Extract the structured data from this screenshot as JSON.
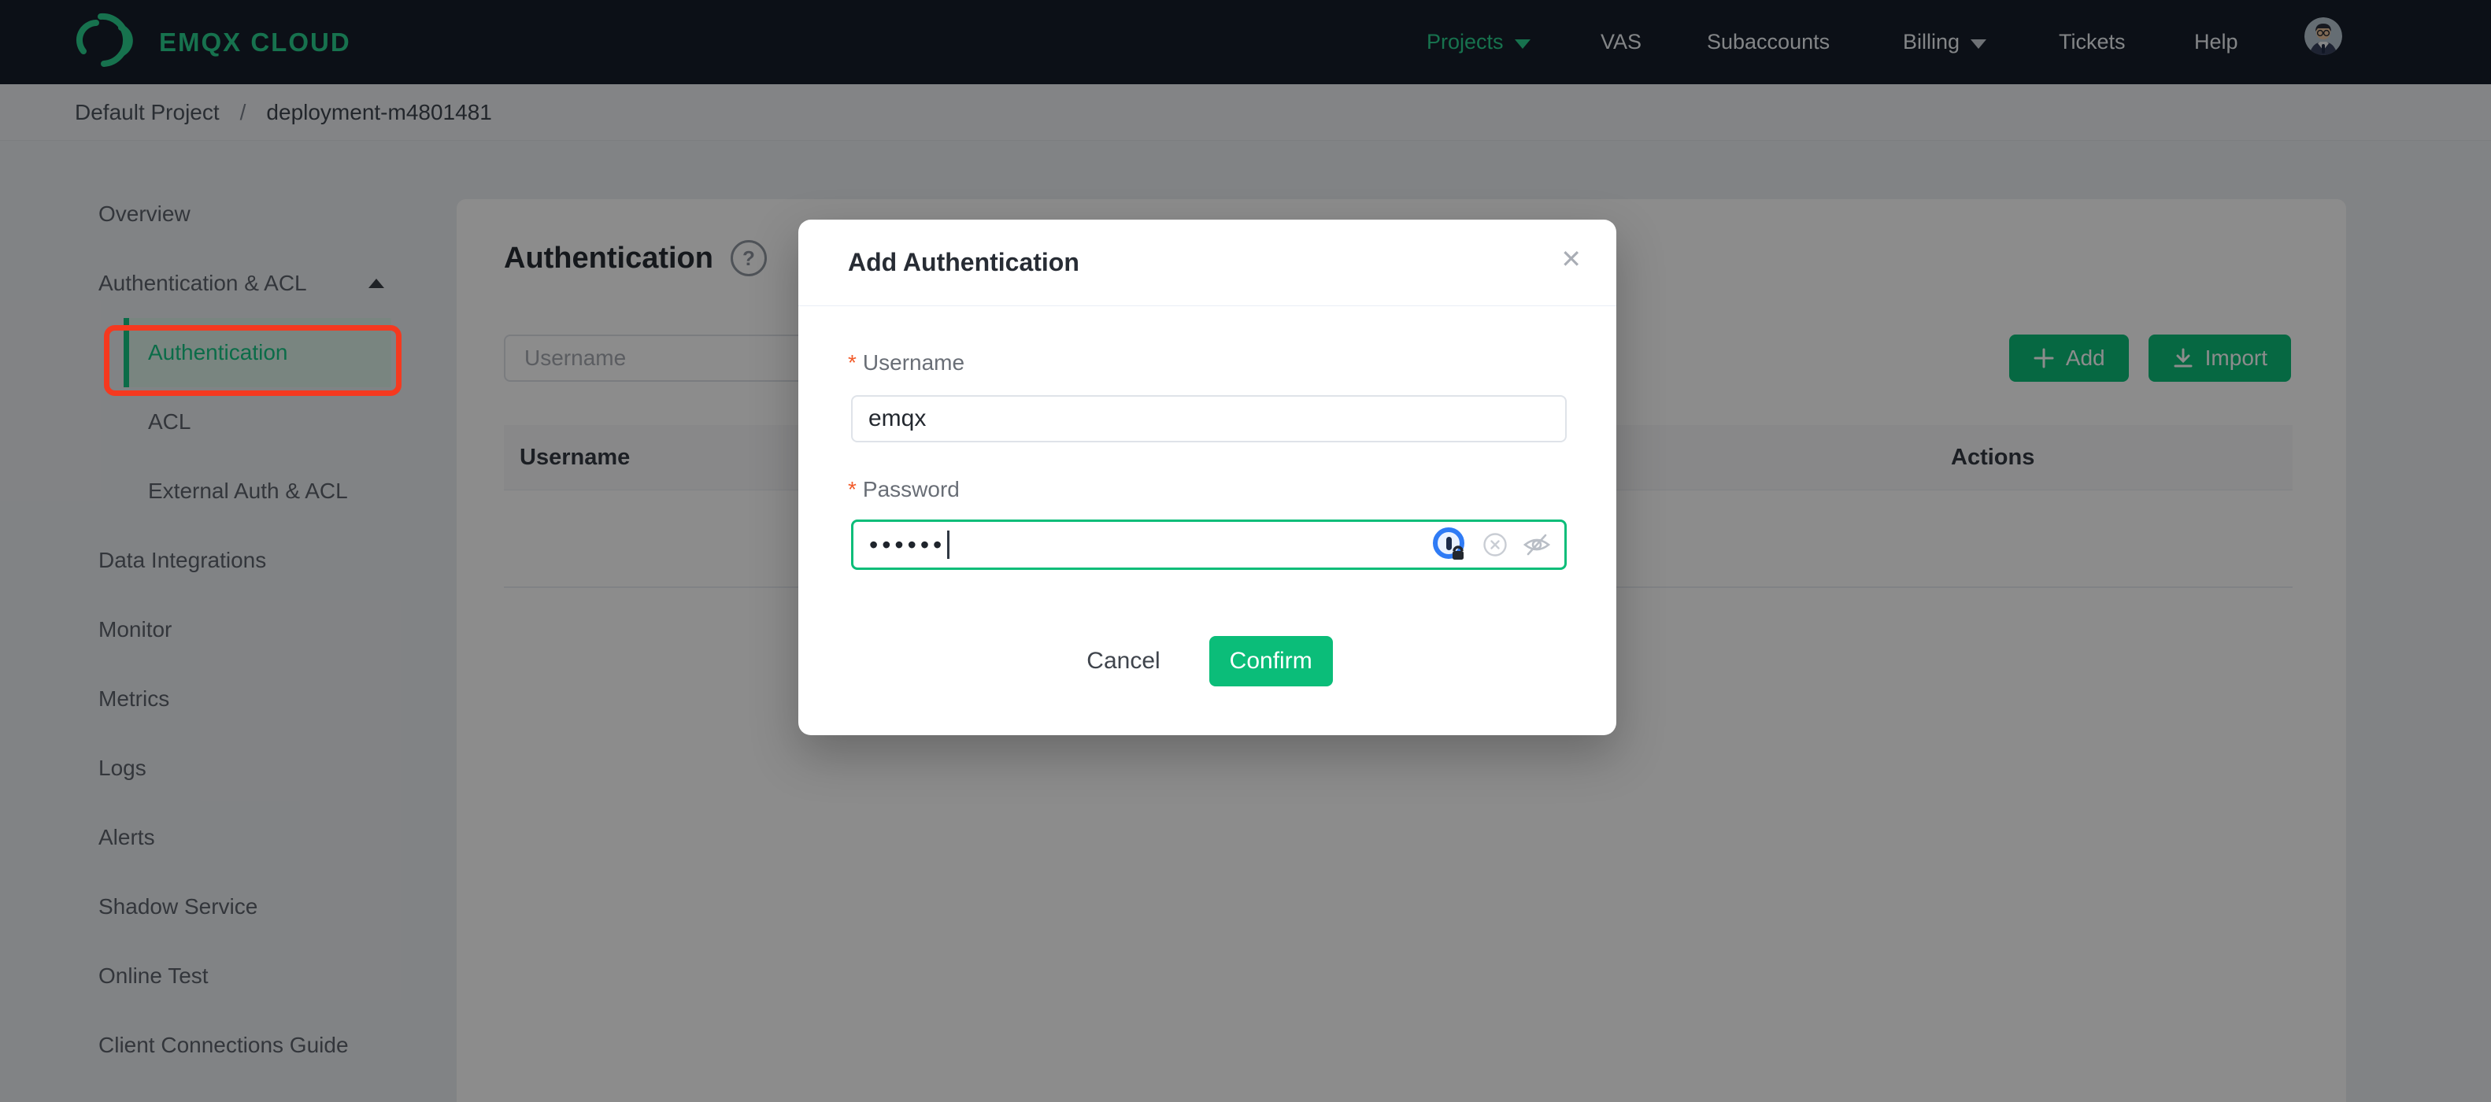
{
  "topbar": {
    "logo_text": "EMQX CLOUD",
    "nav": [
      {
        "label": "Projects",
        "active": true,
        "has_caret": true
      },
      {
        "label": "VAS"
      },
      {
        "label": "Subaccounts"
      },
      {
        "label": "Billing",
        "has_caret": true
      },
      {
        "label": "Tickets"
      },
      {
        "label": "Help"
      }
    ]
  },
  "breadcrumb": {
    "project": "Default Project",
    "separator": "/",
    "deployment": "deployment-m4801481"
  },
  "sidebar": {
    "items": [
      {
        "label": "Overview",
        "level": 1
      },
      {
        "label": "Authentication & ACL",
        "level": 1,
        "expanded": true
      },
      {
        "label": "Authentication",
        "level": 2,
        "active": true,
        "annotated": true
      },
      {
        "label": "ACL",
        "level": 2
      },
      {
        "label": "External Auth & ACL",
        "level": 2
      },
      {
        "label": "Data Integrations",
        "level": 1
      },
      {
        "label": "Monitor",
        "level": 1
      },
      {
        "label": "Metrics",
        "level": 1
      },
      {
        "label": "Logs",
        "level": 1
      },
      {
        "label": "Alerts",
        "level": 1
      },
      {
        "label": "Shadow Service",
        "level": 1
      },
      {
        "label": "Online Test",
        "level": 1
      },
      {
        "label": "Client Connections Guide",
        "level": 1
      }
    ]
  },
  "main": {
    "title": "Authentication",
    "help_icon": "question-circle-icon",
    "search_placeholder": "Username",
    "add_label": "Add",
    "import_label": "Import",
    "table": {
      "columns": [
        "Username",
        "Actions"
      ],
      "rows": []
    }
  },
  "modal": {
    "title": "Add Authentication",
    "close_icon": "✕",
    "username_label": "Username",
    "username_value": "emqx",
    "password_label": "Password",
    "password_masked_value": "••••••",
    "required_marker": "*",
    "cancel_label": "Cancel",
    "confirm_label": "Confirm",
    "password_icons": [
      "password-manager-icon",
      "clear-icon",
      "eye-off-icon"
    ]
  },
  "colors": {
    "brand_green": "#0bbd79",
    "logo_green": "#2bd08e",
    "sidebar_active_green": "#14c584",
    "annotation_red": "#f5391f",
    "topbar_bg": "#161e2a",
    "required_orange": "#f25b2a"
  }
}
